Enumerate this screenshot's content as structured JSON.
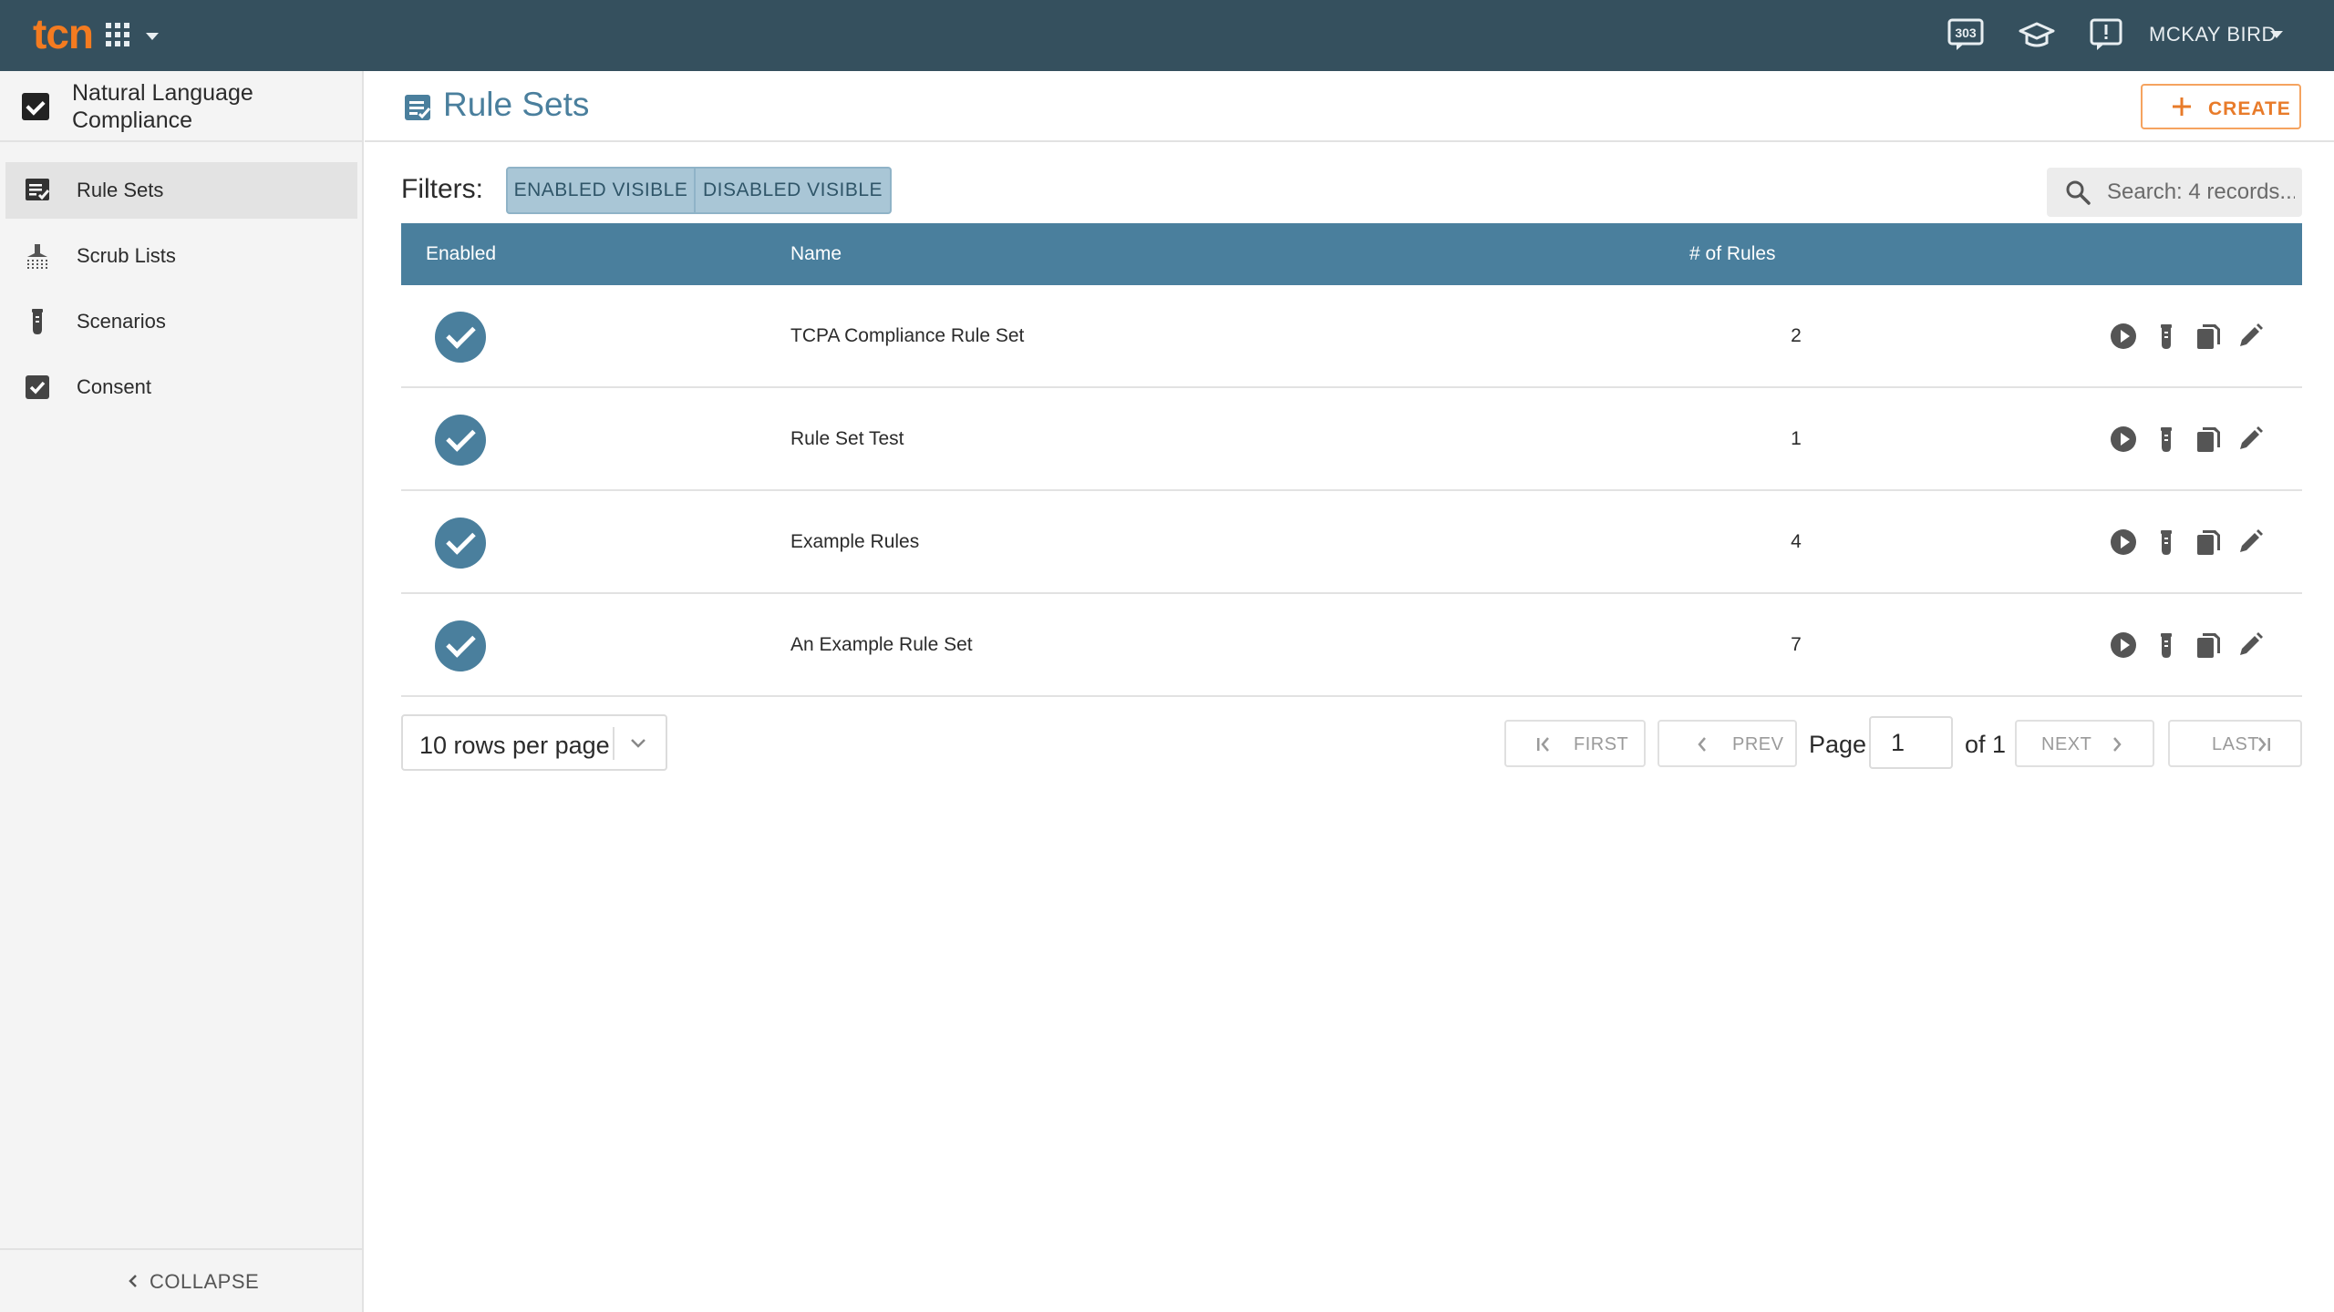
{
  "topbar": {
    "logo": "tcn",
    "notification_count": "303",
    "user_name": "MCKAY BIRD"
  },
  "sidebar": {
    "app_title": "Natural Language Compliance",
    "items": [
      {
        "label": "Rule Sets",
        "icon": "rule-list-icon",
        "active": true
      },
      {
        "label": "Scrub Lists",
        "icon": "scrub-list-icon"
      },
      {
        "label": "Scenarios",
        "icon": "test-tube-icon"
      },
      {
        "label": "Consent",
        "icon": "checkbox-icon"
      }
    ],
    "collapse_label": "COLLAPSE"
  },
  "header": {
    "title": "Rule Sets",
    "create_label": "CREATE"
  },
  "filters": {
    "label": "Filters:",
    "options": [
      "ENABLED VISIBLE",
      "DISABLED VISIBLE"
    ],
    "search_placeholder": "Search: 4 records..."
  },
  "table": {
    "columns": [
      "Enabled",
      "Name",
      "# of Rules"
    ],
    "rows": [
      {
        "enabled": true,
        "name": "TCPA Compliance Rule Set",
        "rules": "2"
      },
      {
        "enabled": true,
        "name": "Rule Set Test",
        "rules": "1"
      },
      {
        "enabled": true,
        "name": "Example Rules",
        "rules": "4"
      },
      {
        "enabled": true,
        "name": "An Example Rule Set",
        "rules": "7"
      }
    ],
    "row_actions": [
      "play-icon",
      "test-tube-icon",
      "copy-icon",
      "edit-icon"
    ]
  },
  "pagination": {
    "rows_per_page": "10 rows per page",
    "first": "FIRST",
    "prev": "PREV",
    "page_label": "Page",
    "page_value": "1",
    "of_label": "of 1",
    "next": "NEXT",
    "last": "LAST"
  },
  "colors": {
    "topbar": "#35505e",
    "accent": "#4a7f9d",
    "brand_orange": "#f47b20"
  }
}
